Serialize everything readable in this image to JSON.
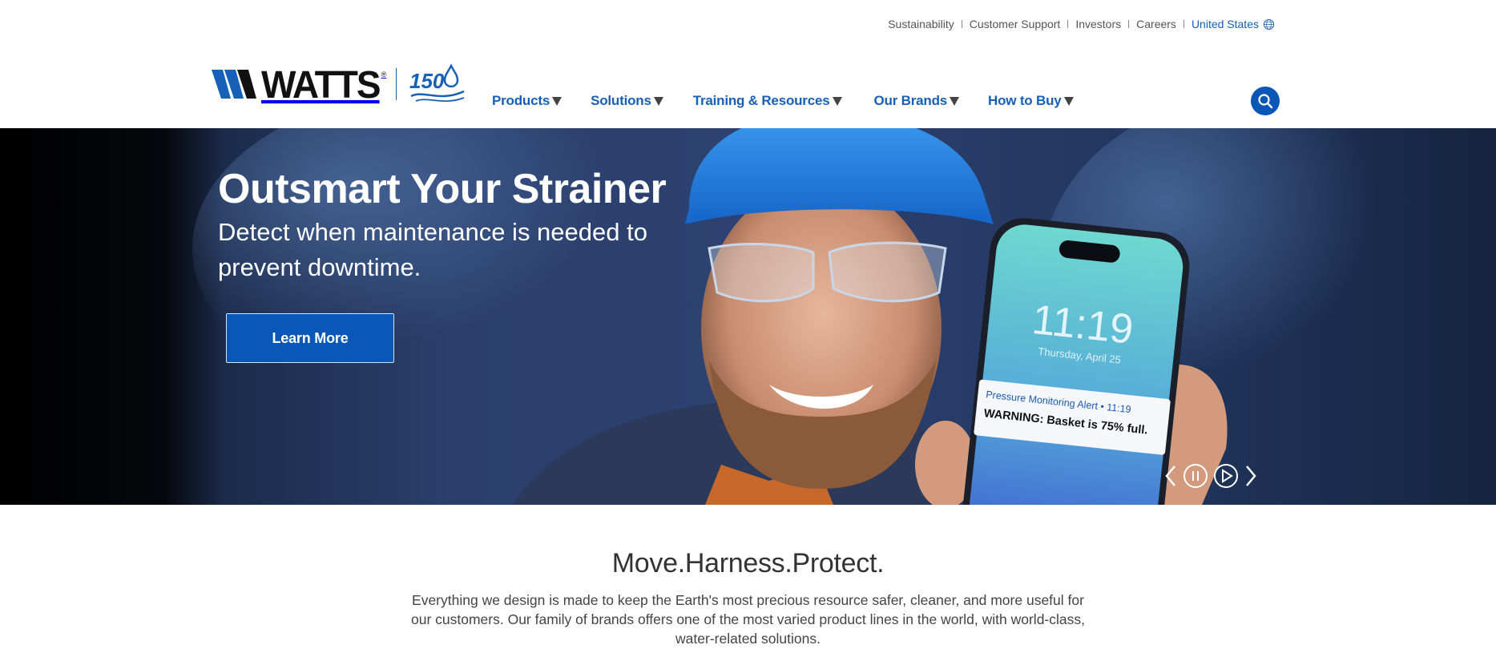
{
  "utility_nav": {
    "links": [
      "Sustainability",
      "Customer Support",
      "Investors",
      "Careers"
    ],
    "country": "United States",
    "country_icon": "globe-icon"
  },
  "brand": {
    "name": "WATTS",
    "anniversary": "150",
    "color": "#1660b8"
  },
  "main_nav": {
    "items": [
      "Products",
      "Solutions",
      "Training & Resources",
      "Our Brands",
      "How to Buy"
    ],
    "caret_icon": "caret-down-icon"
  },
  "search": {
    "icon": "search-icon",
    "color": "#0a57b8"
  },
  "hero": {
    "title": "Outsmart Your Strainer",
    "subtitle": "Detect when maintenance is needed to prevent downtime.",
    "cta_label": "Learn More",
    "phone": {
      "time": "11:19",
      "date": "Thursday, April 25",
      "alert_title": "Pressure Monitoring Alert • 11:19",
      "alert_message": "WARNING: Basket is 75% full."
    },
    "controls": [
      "chevron-left-icon",
      "pause-icon",
      "play-icon",
      "chevron-right-icon"
    ]
  },
  "intro": {
    "title": "Move.Harness.Protect.",
    "body": "Everything we design is made to keep the Earth's most precious resource safer, cleaner, and more useful for our customers. Our family of brands offers one of the most varied product lines in the world, with world-class, water-related solutions."
  }
}
